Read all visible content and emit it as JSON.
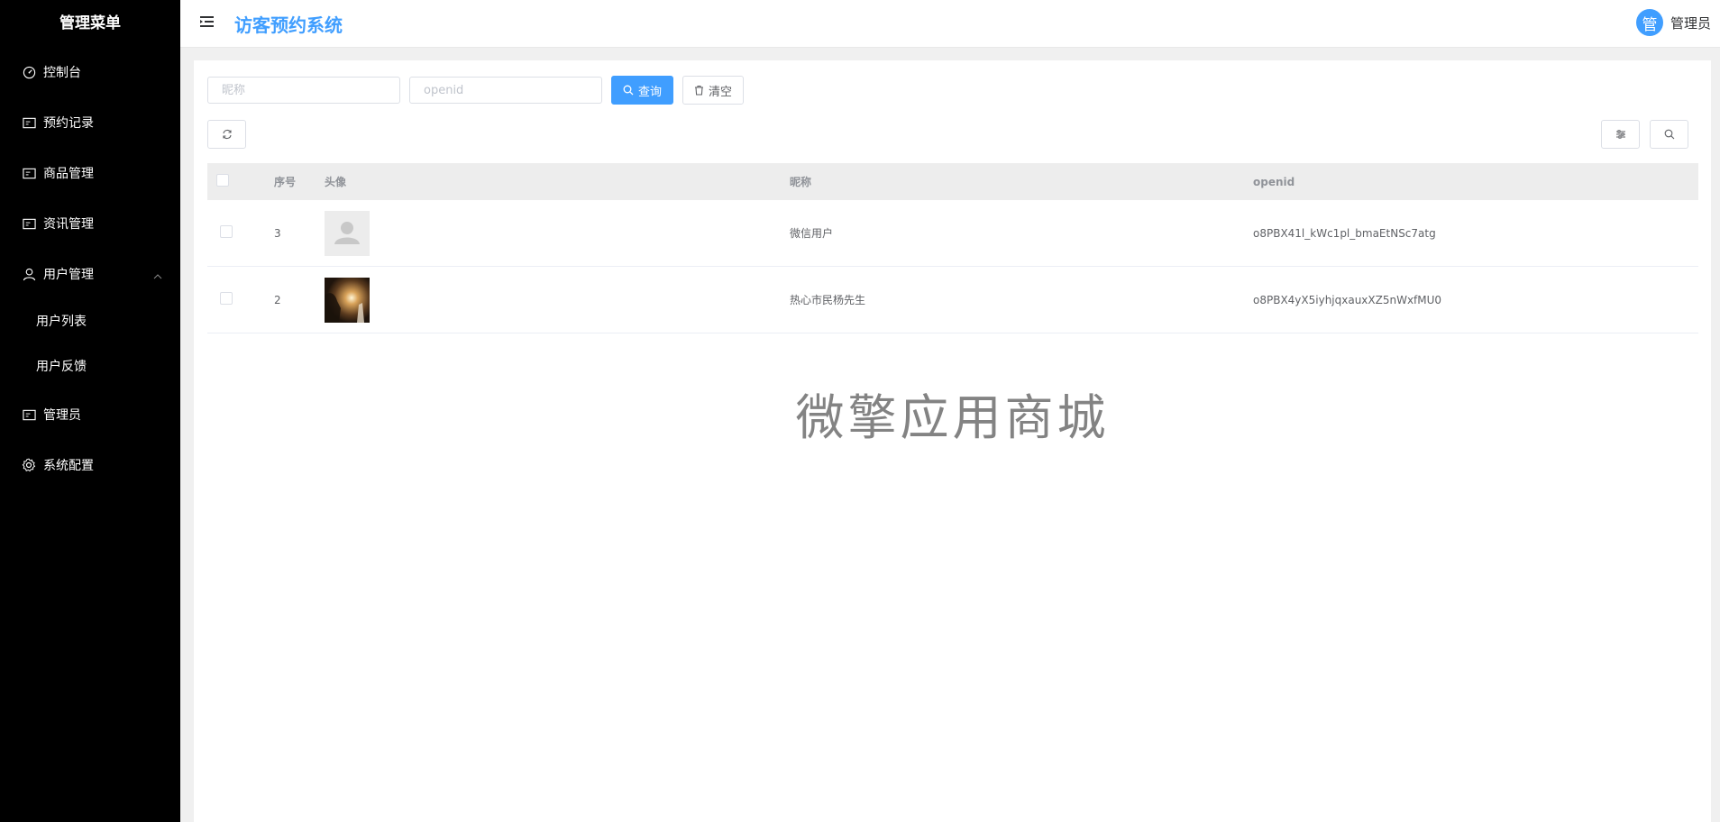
{
  "sidebar": {
    "title": "管理菜单",
    "items": [
      {
        "label": "控制台",
        "icon": "dashboard-icon"
      },
      {
        "label": "预约记录",
        "icon": "card-icon"
      },
      {
        "label": "商品管理",
        "icon": "card-icon"
      },
      {
        "label": "资讯管理",
        "icon": "card-icon"
      },
      {
        "label": "用户管理",
        "icon": "user-icon",
        "expanded": true,
        "children": [
          "用户列表",
          "用户反馈"
        ]
      },
      {
        "label": "管理员",
        "icon": "card-icon"
      },
      {
        "label": "系统配置",
        "icon": "gear-icon"
      }
    ]
  },
  "header": {
    "title": "访客预约系统",
    "avatar_text": "管",
    "user_name": "管理员",
    "accent": "#409eff"
  },
  "search": {
    "nickname_placeholder": "昵称",
    "openid_placeholder": "openid",
    "query_label": "查询",
    "clear_label": "清空"
  },
  "table": {
    "columns": [
      "序号",
      "头像",
      "昵称",
      "openid"
    ],
    "rows": [
      {
        "index": "3",
        "avatar": "default-avatar",
        "nickname": "微信用户",
        "openid": "o8PBX41l_kWc1pl_bmaEtNSc7atg"
      },
      {
        "index": "2",
        "avatar": "photo-avatar",
        "nickname": "热心市民杨先生",
        "openid": "o8PBX4yX5iyhjqxauxXZ5nWxfMU0"
      }
    ]
  },
  "watermark": "微擎应用商城"
}
